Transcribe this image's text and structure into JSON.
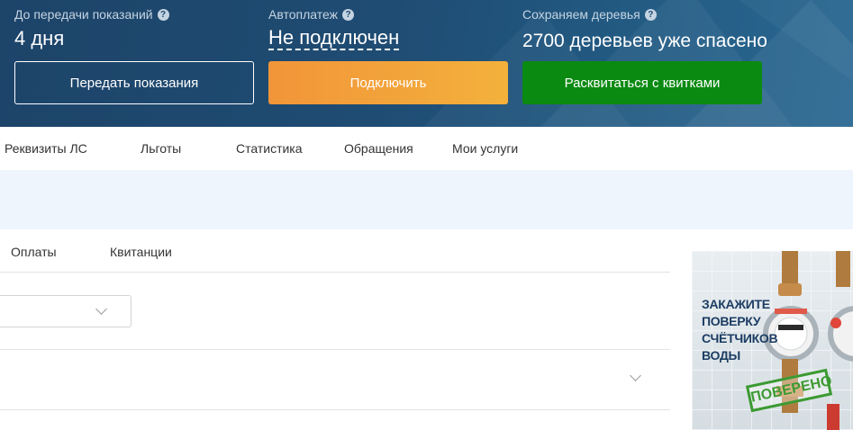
{
  "header": {
    "readings": {
      "label": "До передачи показаний",
      "value": "4 дня",
      "button": "Передать показания"
    },
    "autopay": {
      "label": "Автоплатеж",
      "value": "Не подключен",
      "button": "Подключить"
    },
    "trees": {
      "label": "Сохраняем деревья",
      "value": "2700 деревьев уже спасено",
      "button": "Расквитаться с квитками"
    },
    "help_glyph": "?"
  },
  "nav": {
    "items": [
      "Реквизиты ЛС",
      "Льготы",
      "Статистика",
      "Обращения",
      "Мои услуги"
    ]
  },
  "subtabs": {
    "items": [
      "Оплаты",
      "Квитанции"
    ]
  },
  "ad": {
    "text": [
      "ЗАКАЖИТЕ",
      "ПОВЕРКУ",
      "СЧЁТЧИКОВ",
      "ВОДЫ"
    ],
    "stamp": "ПОВЕРЕНО"
  },
  "colors": {
    "banner": "#1f4a70",
    "orange": "#f3a23a",
    "green": "#0b8a12",
    "info_strip": "#eef5fd"
  }
}
